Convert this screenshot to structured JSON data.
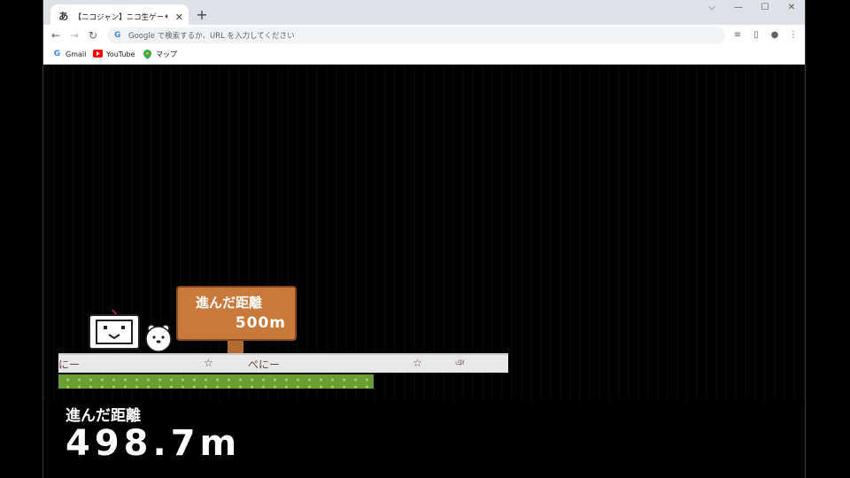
{
  "browser": {
    "tab_title": "【ニコジャン】ニコ生ゲーム練習枠",
    "tab_favicon": "あ",
    "tab_audio_icon": "speaker-icon",
    "tab_close": "✕",
    "new_tab": "+",
    "window_controls": {
      "chevron": "⌵",
      "minimize": "—",
      "maximize": "☐",
      "close": "✕"
    },
    "omnibox_placeholder": "Google で検索するか、URL を入力してください",
    "bookmarks": [
      {
        "label": "Gmail",
        "icon": "gmail-icon",
        "color": "#ea4335"
      },
      {
        "label": "YouTube",
        "icon": "youtube-icon",
        "color": "#ff0000"
      },
      {
        "label": "マップ",
        "icon": "maps-icon",
        "color": "#34a853"
      }
    ]
  },
  "game": {
    "sign_label": "進んだ距離",
    "sign_value": "500m",
    "ticker": [
      "にー",
      "☆",
      "ぺにー",
      "☆",
      "ঞ"
    ],
    "distance_label": "進んだ距離",
    "distance_value": "498.7m",
    "colors": {
      "sign": "#c9793a",
      "grass": "#6a9e33",
      "ticker": "#e8e8e8"
    }
  }
}
